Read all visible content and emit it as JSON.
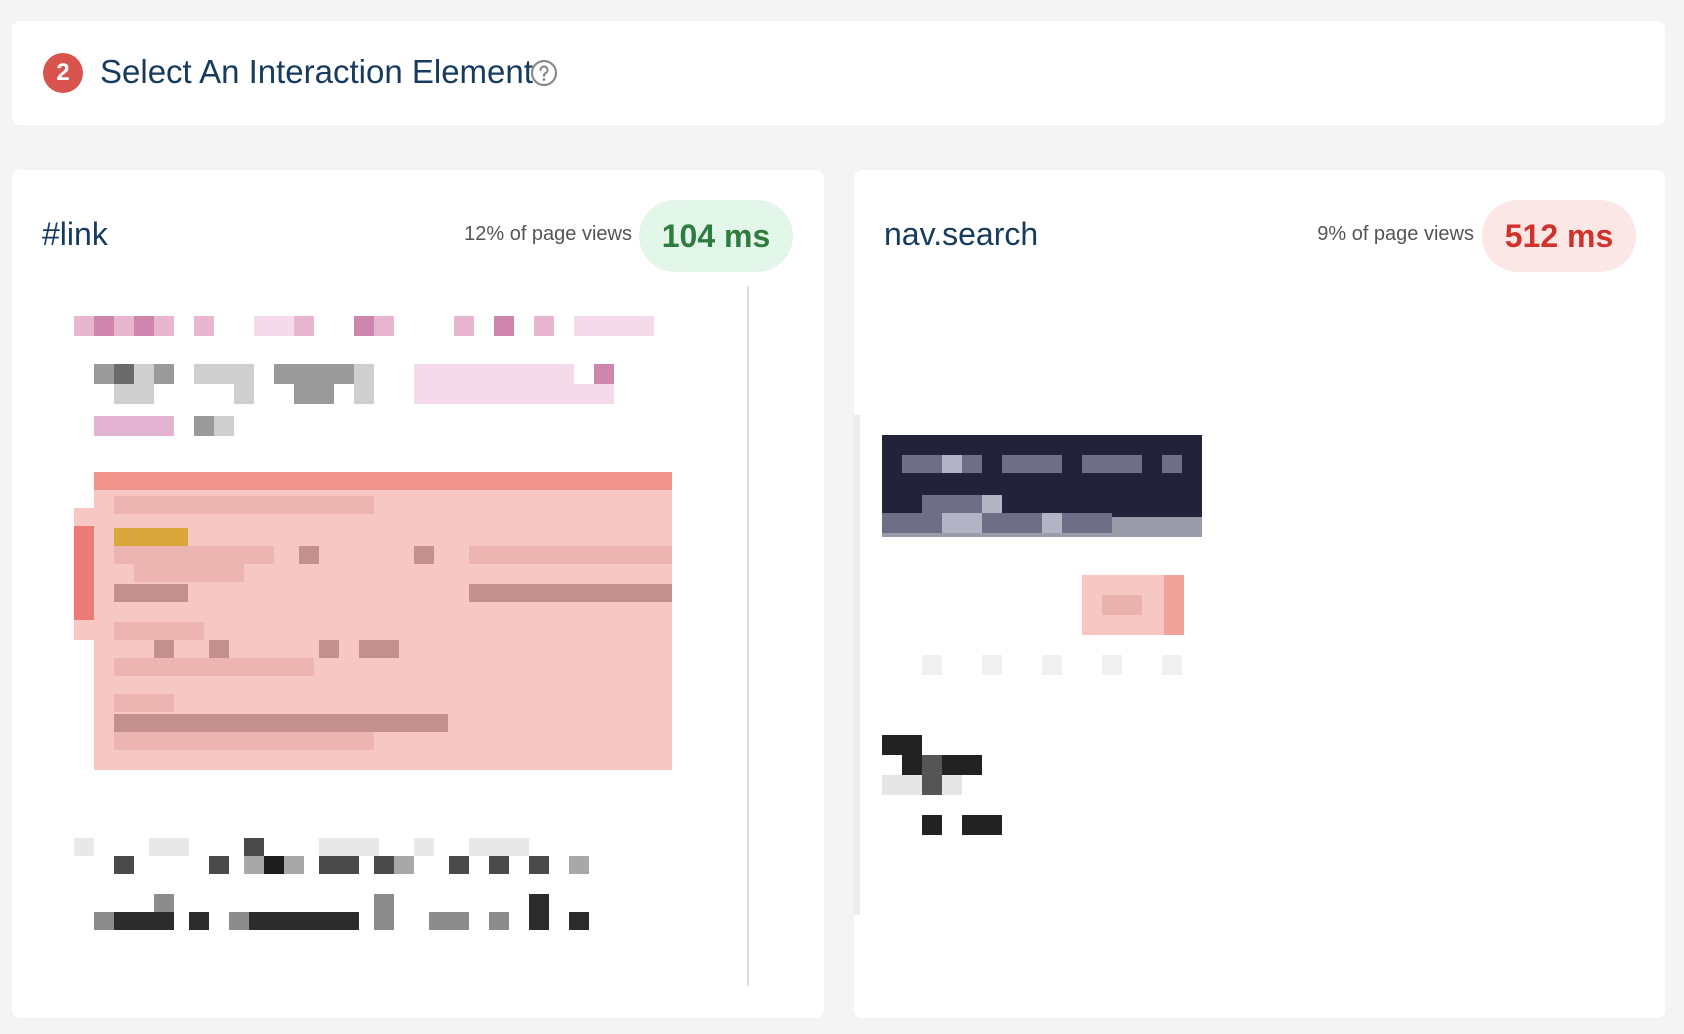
{
  "header": {
    "step_number": "2",
    "title": "Select An Interaction Element"
  },
  "elements": [
    {
      "selector": "#link",
      "page_views": "12% of page views",
      "duration": "104 ms",
      "status": "good",
      "status_color": "#2e7d3e"
    },
    {
      "selector": "nav.search",
      "page_views": "9% of page views",
      "duration": "512 ms",
      "status": "bad",
      "status_color": "#d0332c"
    }
  ],
  "icons": {
    "help": "question-circle"
  }
}
